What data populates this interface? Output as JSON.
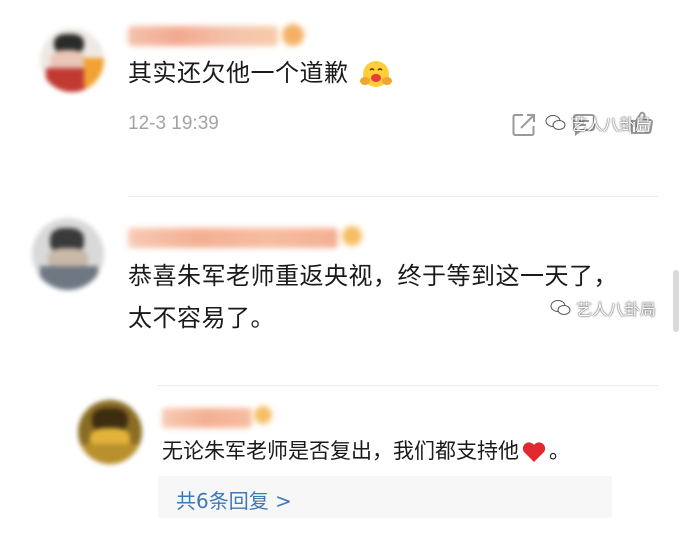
{
  "comments": [
    {
      "text": "其实还欠他一个道歉",
      "time": "12-3 19:39",
      "avatar_icon": "blurred-avatar-icon",
      "emoji": "hug-face-emoji"
    },
    {
      "text_line1": "恭喜朱军老师重返央视，终于等到这一天了，",
      "text_line2": "太不容易了。",
      "avatar_icon": "blurred-avatar-icon"
    }
  ],
  "reply": {
    "text_before": "无论朱军老师是否复出，我们都支持他",
    "text_after": "。",
    "emoji": "red-heart-emoji",
    "avatar_icon": "blurred-avatar-icon",
    "more_replies": "共6条回复 >"
  },
  "watermark": {
    "text": "艺人八卦局",
    "icon": "wechat-logo-icon"
  },
  "colors": {
    "link": "#3f77b8",
    "time": "#a3a3a3",
    "heart": "#e0282e",
    "reply_bg": "#f7f7f7"
  }
}
